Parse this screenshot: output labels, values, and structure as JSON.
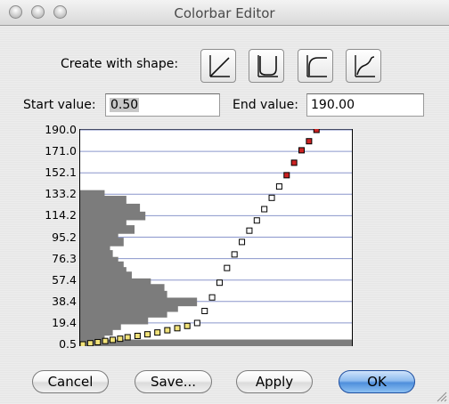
{
  "window": {
    "title": "Colorbar Editor"
  },
  "shape": {
    "label": "Create with shape:",
    "buttons": [
      "linear-shape-icon",
      "u-curve-shape-icon",
      "log-curve-shape-icon",
      "s-curve-shape-icon"
    ]
  },
  "start": {
    "label": "Start value:",
    "value": "0.50"
  },
  "end": {
    "label": "End value:",
    "value": "190.00"
  },
  "buttons": {
    "cancel": "Cancel",
    "save": "Save...",
    "apply": "Apply",
    "ok": "OK"
  },
  "colors": {
    "gridline": "#8a96cc",
    "histogram": "#7c7c7c",
    "point_low": "#f1e27a",
    "point_mid": "#ffffff",
    "point_high": "#cc2222",
    "ok_button": "#4f8fdc"
  },
  "chart_data": {
    "type": "scatter",
    "ylim": [
      0.5,
      190.0
    ],
    "yticks": [
      "190.0",
      "171.0",
      "152.1",
      "133.2",
      "114.2",
      "95.2",
      "76.3",
      "57.4",
      "38.4",
      "19.4",
      "0.5"
    ],
    "grid": true,
    "histogram": {
      "orientation": "horizontal",
      "bins_y": [
        133,
        128,
        121,
        114,
        109,
        102,
        97,
        91,
        86,
        80,
        74,
        70,
        65,
        61,
        55,
        50,
        44,
        38,
        33,
        28,
        22,
        17,
        12,
        7,
        1
      ],
      "counts": [
        0.09,
        0.17,
        0.22,
        0.24,
        0.17,
        0.2,
        0.14,
        0.16,
        0.11,
        0.12,
        0.14,
        0.16,
        0.17,
        0.19,
        0.26,
        0.31,
        0.32,
        0.43,
        0.36,
        0.32,
        0.25,
        0.15,
        0.12,
        0.09,
        1.0
      ]
    },
    "points": {
      "x": [
        0,
        0.03,
        0.06,
        0.09,
        0.12,
        0.15,
        0.18,
        0.22,
        0.26,
        0.3,
        0.34,
        0.38,
        0.42,
        0.46,
        0.49,
        0.52,
        0.55,
        0.58,
        0.61,
        0.64,
        0.67,
        0.7,
        0.73,
        0.76,
        0.79,
        0.82,
        0.85,
        0.88,
        0.91,
        0.94,
        0.97,
        1.0
      ],
      "y": [
        0.5,
        1.5,
        2.5,
        3.5,
        4.5,
        5.5,
        6.8,
        8.0,
        9.4,
        11.0,
        13.0,
        14.8,
        16.8,
        19.4,
        30,
        42,
        55,
        68,
        80,
        91,
        101,
        110,
        120,
        130,
        140,
        150,
        161,
        172,
        180,
        190,
        190,
        190
      ]
    }
  }
}
